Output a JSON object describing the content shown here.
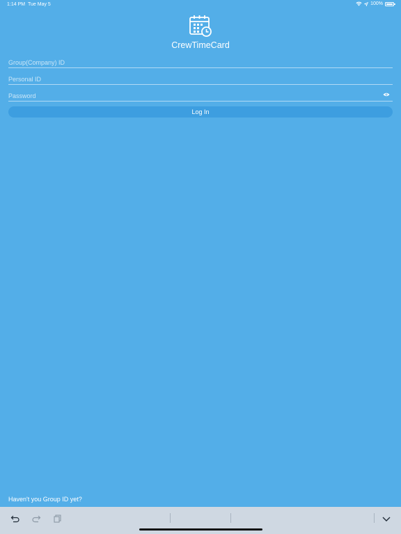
{
  "status_bar": {
    "time": "1:14 PM",
    "date": "Tue May 5",
    "battery": "100%",
    "wifi_icon": "wifi-icon",
    "location_icon": "location-arrow-icon",
    "battery_icon": "battery-icon"
  },
  "app": {
    "title": "CrewTimeCard",
    "logo_icon": "calendar-clock-icon"
  },
  "form": {
    "group_id_placeholder": "Group(Company) ID",
    "personal_id_placeholder": "Personal ID",
    "password_placeholder": "Password",
    "login_label": "Log In",
    "show_password_icon": "eye-icon"
  },
  "footer": {
    "no_group_link": "Haven't you Group ID yet?"
  },
  "keyboard_toolbar": {
    "undo_icon": "undo-icon",
    "redo_icon": "redo-icon",
    "paste_icon": "paste-icon",
    "dismiss_icon": "chevron-down-icon"
  },
  "colors": {
    "background": "#53aee8",
    "button": "#3d9ee0",
    "toolbar": "#cfd8e2"
  }
}
